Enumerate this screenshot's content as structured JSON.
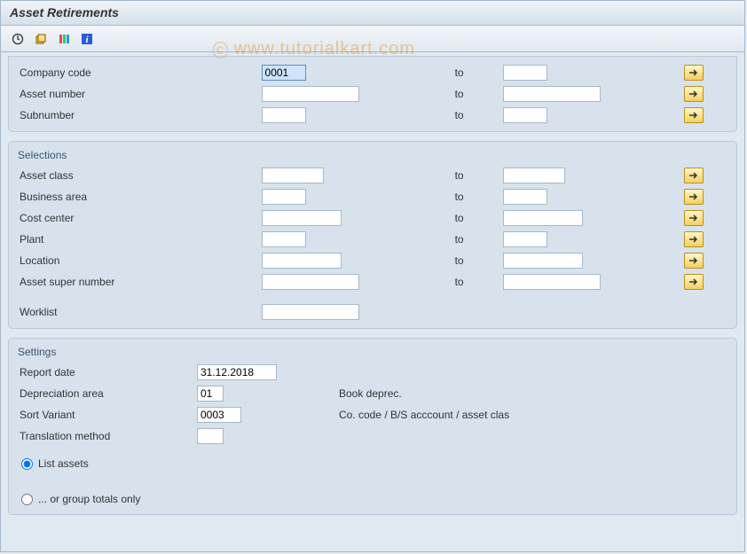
{
  "title": "Asset Retirements",
  "watermark": "www.tutorialkart.com",
  "toolbar": {
    "b1": "execute",
    "b2": "variant",
    "b3": "options",
    "b4": "info"
  },
  "top": {
    "rows": [
      {
        "label": "Company code",
        "v1": "0001",
        "to": "to",
        "v2": "",
        "w1": "w50",
        "w2": "w50",
        "sel": true
      },
      {
        "label": "Asset number",
        "v1": "",
        "to": "to",
        "v2": "",
        "w1": "w110",
        "w2": "w110",
        "sel": false
      },
      {
        "label": "Subnumber",
        "v1": "",
        "to": "to",
        "v2": "",
        "w1": "w50",
        "w2": "w50",
        "sel": false
      }
    ]
  },
  "selections": {
    "title": "Selections",
    "rows": [
      {
        "label": "Asset class",
        "v1": "",
        "to": "to",
        "v2": "",
        "w1": "w70",
        "w2": "w70"
      },
      {
        "label": "Business area",
        "v1": "",
        "to": "to",
        "v2": "",
        "w1": "w50",
        "w2": "w50"
      },
      {
        "label": "Cost center",
        "v1": "",
        "to": "to",
        "v2": "",
        "w1": "w90",
        "w2": "w90"
      },
      {
        "label": "Plant",
        "v1": "",
        "to": "to",
        "v2": "",
        "w1": "w50",
        "w2": "w50"
      },
      {
        "label": "Location",
        "v1": "",
        "to": "to",
        "v2": "",
        "w1": "w90",
        "w2": "w90"
      },
      {
        "label": "Asset super number",
        "v1": "",
        "to": "to",
        "v2": "",
        "w1": "w110",
        "w2": "w110"
      }
    ],
    "worklist_label": "Worklist",
    "worklist_value": ""
  },
  "settings": {
    "title": "Settings",
    "rows": [
      {
        "label": "Report date",
        "value": "31.12.2018",
        "w": "w90",
        "desc": ""
      },
      {
        "label": "Depreciation area",
        "value": "01",
        "w": "w30",
        "desc": "Book deprec."
      },
      {
        "label": "Sort Variant",
        "value": "0003",
        "w": "w50",
        "desc": "Co. code / B/S acccount / asset clas"
      },
      {
        "label": "Translation method",
        "value": "",
        "w": "w30",
        "desc": ""
      }
    ],
    "radio1": "List assets",
    "radio2": "... or group totals only",
    "radio_selected": 0
  }
}
